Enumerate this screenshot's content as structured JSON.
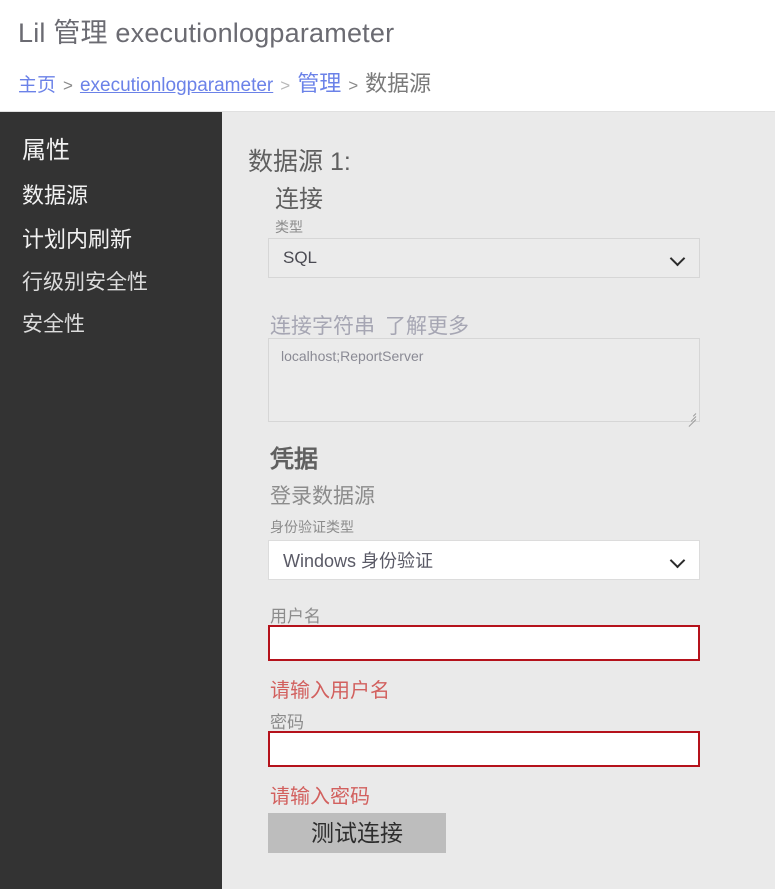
{
  "header": {
    "title": "Lil 管理 executionlogparameter",
    "breadcrumb": {
      "home": "主页",
      "sep1": ">",
      "item": "executionlogparameter",
      "sep2": ">",
      "manage": "管理",
      "sep3": ">",
      "current": "数据源"
    }
  },
  "sidebar": {
    "items": [
      {
        "label": "属性"
      },
      {
        "label": "数据源"
      },
      {
        "label": "计划内刷新"
      },
      {
        "label": "行级别安全性"
      },
      {
        "label": "安全性"
      }
    ]
  },
  "main": {
    "datasource_title": "数据源 1:",
    "connection": {
      "section_title": "连接",
      "type_label": "类型",
      "type_value": "SQL",
      "type_options": [
        "SQL"
      ],
      "connstring_label": "连接字符串",
      "connstring_learnmore": "了解更多",
      "connstring_value": "localhost;ReportServer"
    },
    "credentials": {
      "section_title": "凭据",
      "login_subtitle": "登录数据源",
      "authtype_label": "身份验证类型",
      "authtype_value": "Windows 身份验证",
      "authtype_options": [
        "Windows 身份验证"
      ],
      "username_label": "用户名",
      "username_value": "",
      "username_error": "请输入用户名",
      "password_label": "密码",
      "password_value": "",
      "password_error": "请输入密码",
      "test_button": "测试连接"
    }
  },
  "colors": {
    "sidebar_bg": "#333333",
    "content_bg": "#eaeaea",
    "link": "#6b82e8",
    "error_border": "#b5121b",
    "error_text": "#d2605e",
    "button_bg": "#bdbdbd"
  }
}
